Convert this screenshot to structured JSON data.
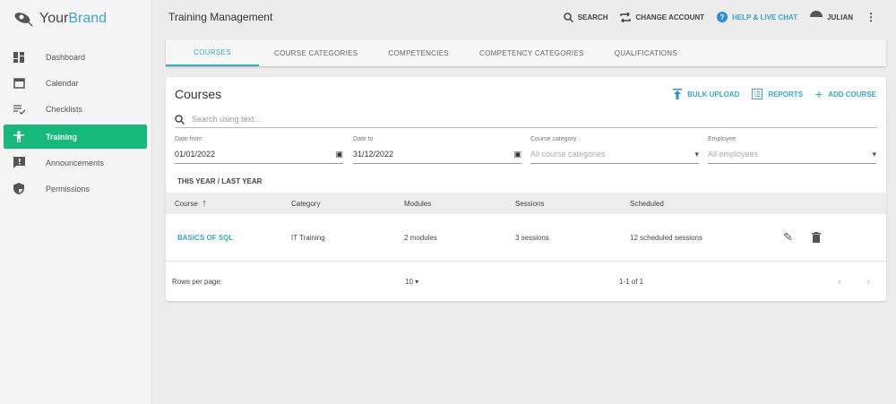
{
  "brand": {
    "name_a": "Your",
    "name_b": "Brand"
  },
  "sidebar": {
    "items": [
      {
        "label": "Dashboard",
        "icon": "dashboard-icon"
      },
      {
        "label": "Calendar",
        "icon": "calendar-icon"
      },
      {
        "label": "Checklists",
        "icon": "checklist-icon"
      },
      {
        "label": "Training",
        "icon": "training-icon",
        "active": true
      },
      {
        "label": "Announcements",
        "icon": "announcement-icon"
      },
      {
        "label": "Permissions",
        "icon": "shield-icon"
      }
    ]
  },
  "header": {
    "title": "Training Management",
    "search": "SEARCH",
    "change_account": "CHANGE ACCOUNT",
    "help": "HELP & LIVE CHAT",
    "user": "JULIAN"
  },
  "tabs": [
    "COURSES",
    "COURSE CATEGORIES",
    "COMPETENCIES",
    "COMPETENCY CATEGORIES",
    "QUALIFICATIONS"
  ],
  "card": {
    "title": "Courses",
    "bulk_upload": "BULK UPLOAD",
    "reports": "REPORTS",
    "add_course": "ADD COURSE",
    "search_placeholder": "Search using text...",
    "filters": {
      "date_from_label": "Date from",
      "date_from": "01/01/2022",
      "date_to_label": "Date to",
      "date_to": "31/12/2022",
      "category_label": "Course category",
      "category": "All course categories",
      "employee_label": "Employee",
      "employee": "All employees"
    },
    "quick": {
      "this_year": "THIS YEAR",
      "sep": "/",
      "last_year": "LAST YEAR"
    },
    "columns": [
      "Course",
      "Category",
      "Modules",
      "Sessions",
      "Scheduled"
    ],
    "rows": [
      {
        "course": "BASICS OF SQL",
        "category": "IT Training",
        "modules": "2 modules",
        "sessions": "3 sessions",
        "scheduled": "12 scheduled sessions"
      }
    ],
    "footer": {
      "rows_per_page_label": "Rows per page:",
      "rows_per_page": "10",
      "range": "1-1 of 1"
    }
  },
  "colors": {
    "accent": "#3aa7c0",
    "active_nav": "#16b97a"
  }
}
